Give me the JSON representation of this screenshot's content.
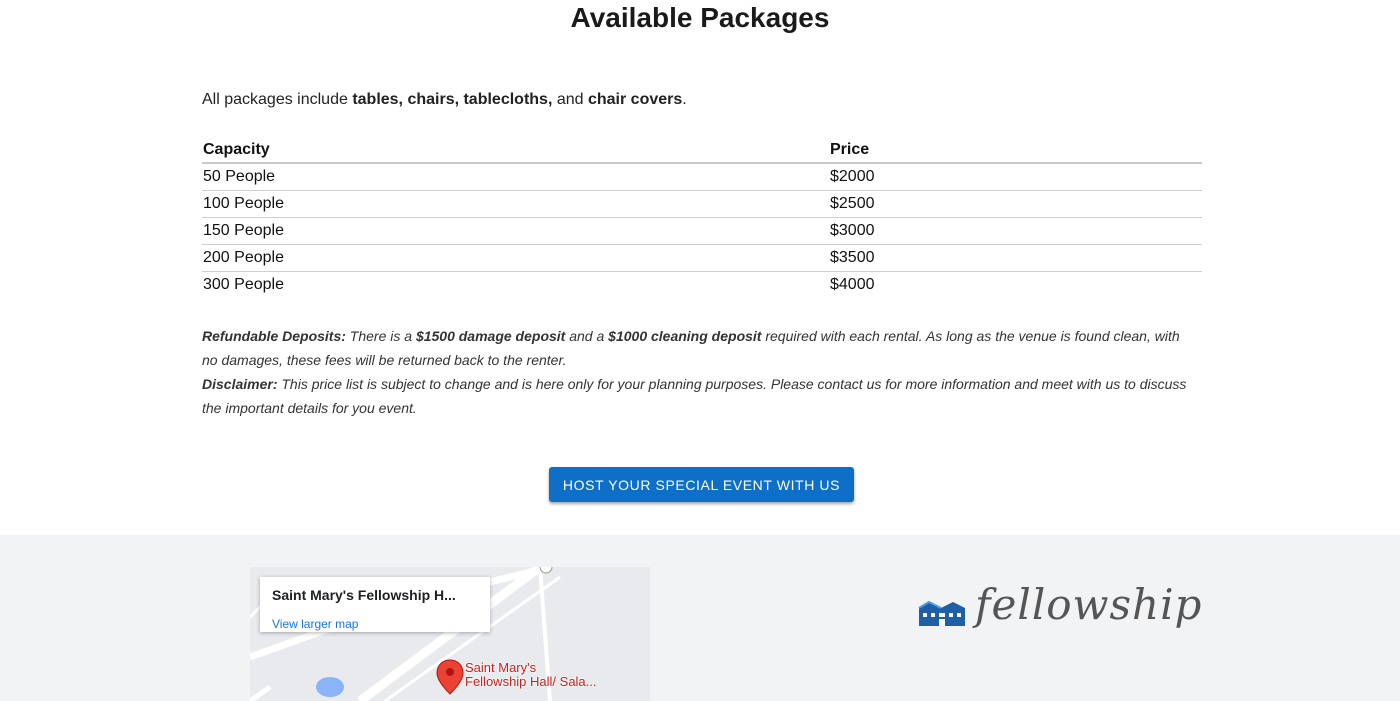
{
  "title": "Available Packages",
  "intro": {
    "prefix": "All packages include ",
    "bold_items": "tables, chairs, tablecloths,",
    "and": " and ",
    "bold_last": "chair covers",
    "period": "."
  },
  "packages": {
    "headers": [
      "Capacity",
      "Price"
    ],
    "rows": [
      [
        "50 People",
        "$2000"
      ],
      [
        "100 People",
        "$2500"
      ],
      [
        "150 People",
        "$3000"
      ],
      [
        "200 People",
        "$3500"
      ],
      [
        "300 People",
        "$4000"
      ]
    ]
  },
  "notes": {
    "deposit_label": "Refundable Deposits:",
    "deposit_t1": " There is a ",
    "deposit_b1": "$1500 damage deposit",
    "deposit_t2": " and a ",
    "deposit_b2": "$1000 cleaning deposit",
    "deposit_t3": " required with each rental. As long as the venue is found clean, with no damages, these fees will be returned back to the renter.",
    "disclaimer_label": "Disclaimer:",
    "disclaimer_text": " This price list is subject to change and is here only for your planning purposes. Please contact us for more information and meet with us to discuss the important details for you event."
  },
  "cta": {
    "label": "Host your special event with us"
  },
  "map": {
    "place_name": "Saint Mary's Fellowship H...",
    "larger_link": "View larger map",
    "pin_label_line1": "Saint Mary's",
    "pin_label_line2": "Fellowship Hall/ Sala..."
  },
  "logo": {
    "text": "fellowship",
    "icon": "building-icon"
  },
  "colors": {
    "cta_bg": "#0d6fc7",
    "footer_bg": "#f1f3f5",
    "pin": "#ea4335",
    "logo_icon": "#1f5fa8"
  }
}
